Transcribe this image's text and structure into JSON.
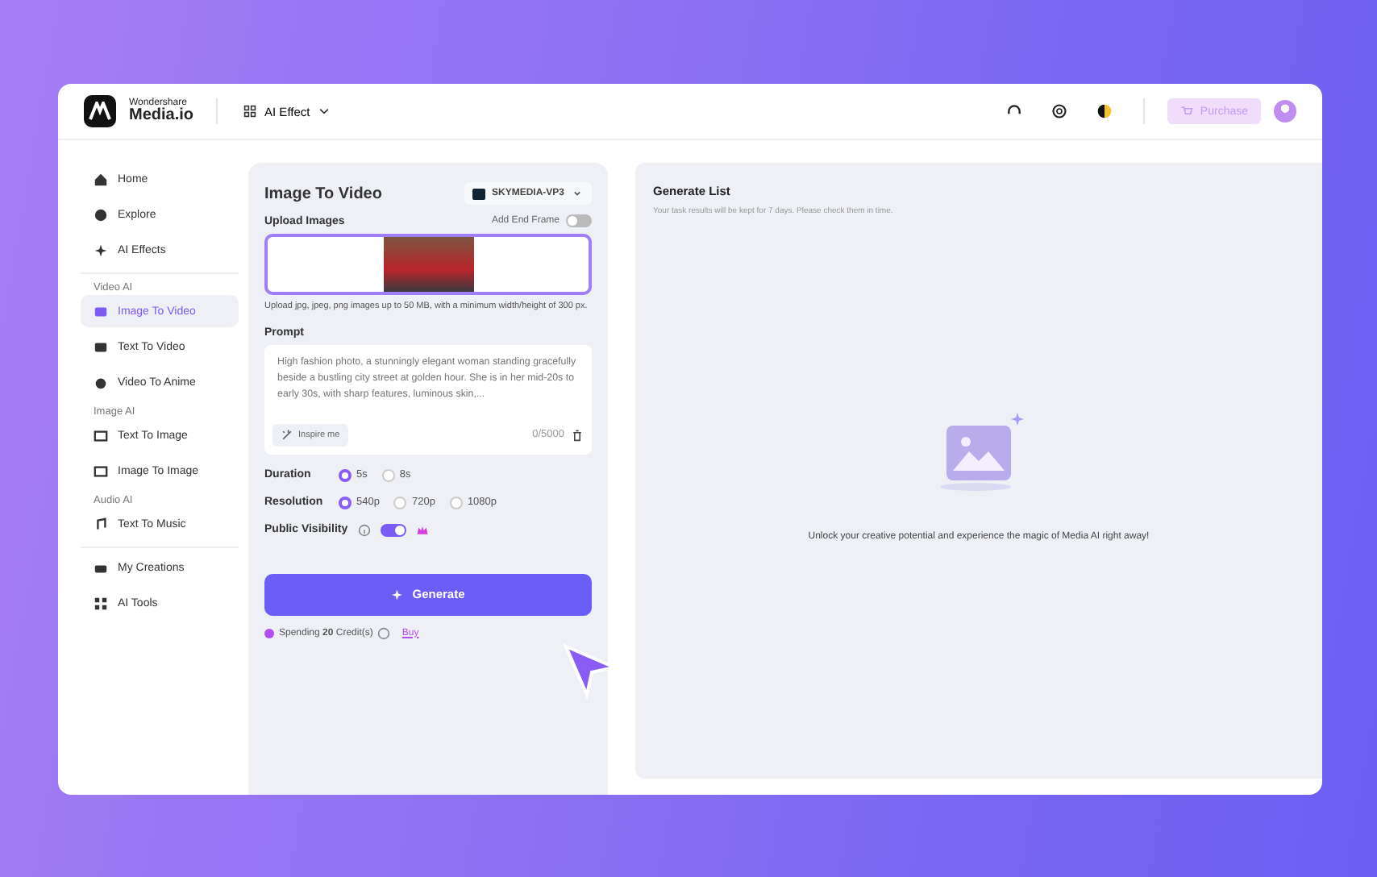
{
  "header": {
    "brand_top": "Wondershare",
    "brand_main": "Media.io",
    "menu": "AI Effect",
    "purchase": "Purchase"
  },
  "sidebar": {
    "items": [
      {
        "kind": "item",
        "label": "Home",
        "selected": false
      },
      {
        "kind": "item",
        "label": "Explore",
        "selected": false
      },
      {
        "kind": "item",
        "label": "AI Effects",
        "selected": false
      },
      {
        "kind": "divider"
      },
      {
        "kind": "section",
        "label": "Video AI"
      },
      {
        "kind": "item",
        "label": "Image To Video",
        "selected": true
      },
      {
        "kind": "item",
        "label": "Text To Video",
        "selected": false
      },
      {
        "kind": "item",
        "label": "Video To Anime",
        "selected": false
      },
      {
        "kind": "section",
        "label": "Image AI"
      },
      {
        "kind": "item",
        "label": "Text To Image",
        "selected": false
      },
      {
        "kind": "item",
        "label": "Image To Image",
        "selected": false
      },
      {
        "kind": "section",
        "label": "Audio AI"
      },
      {
        "kind": "item",
        "label": "Text To Music",
        "selected": false
      },
      {
        "kind": "divider"
      },
      {
        "kind": "item",
        "label": "My Creations",
        "selected": false
      },
      {
        "kind": "item",
        "label": "AI Tools",
        "selected": false
      }
    ]
  },
  "form": {
    "title": "Image To Video",
    "model": "SKYMEDIA-VP3",
    "upload_label": "Upload Images",
    "end_frame_label": "Add End Frame",
    "end_frame_on": false,
    "upload_hint": "Upload jpg, jpeg, png images up to 50 MB, with a minimum width/height of 300 px.",
    "prompt_label": "Prompt",
    "prompt": "High fashion photo, a stunningly elegant woman standing gracefully beside a bustling city street at golden hour. She is in her mid-20s to early 30s, with sharp features, luminous skin,...",
    "inspire": "Inspire me",
    "counter": "0/5000",
    "options": [
      {
        "label": "Duration",
        "choices": [
          {
            "label": "5s",
            "selected": true
          },
          {
            "label": "8s",
            "selected": false
          }
        ]
      },
      {
        "label": "Resolution",
        "choices": [
          {
            "label": "540p",
            "selected": true
          },
          {
            "label": "720p",
            "selected": false
          },
          {
            "label": "1080p",
            "selected": false
          }
        ]
      }
    ],
    "visibility_label": "Public Visibility",
    "visibility_on": true,
    "generate": "Generate",
    "spending": "Spending **20** Credit(s)",
    "buy": "Buy"
  },
  "results": {
    "title": "Generate List",
    "note": "Your task results will be kept for 7 days. Please check them in time.",
    "empty": "Unlock your creative potential and experience the magic of Media AI right away!"
  }
}
